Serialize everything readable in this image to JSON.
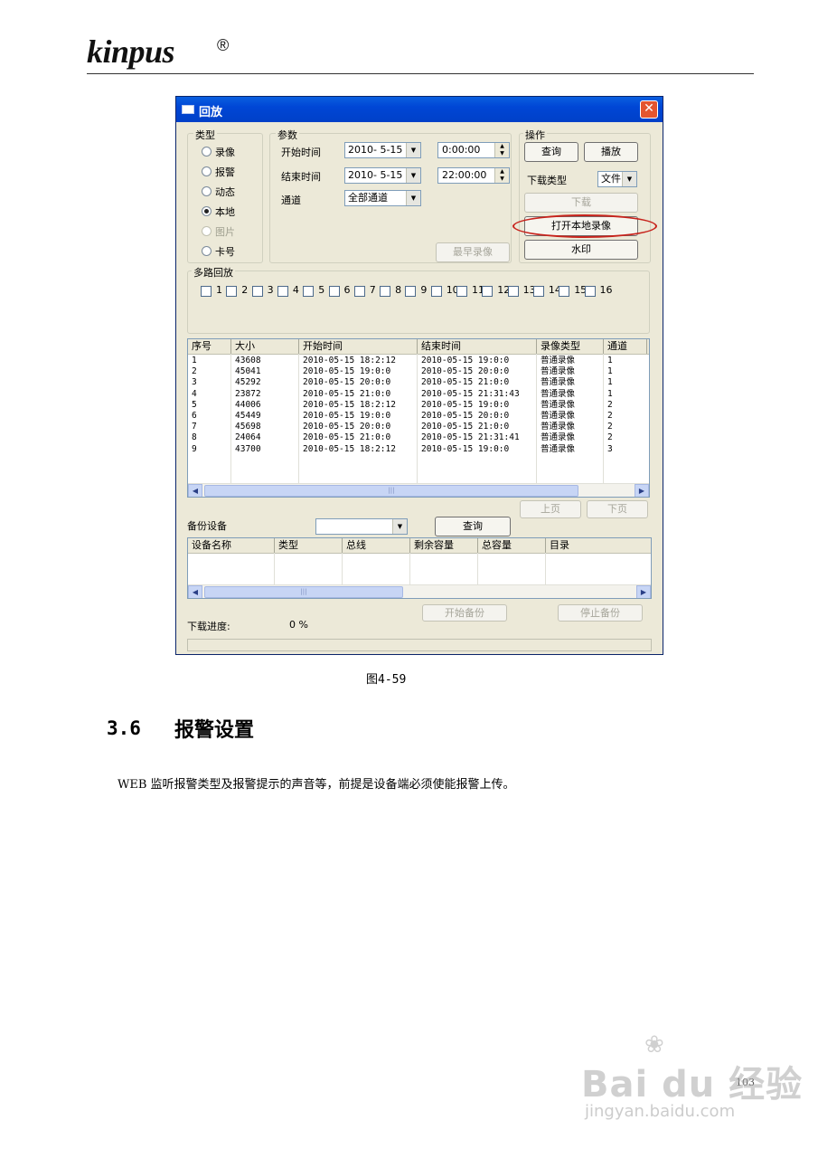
{
  "header": {
    "logo_text": "kinpus",
    "logo_mark": "®"
  },
  "dialog": {
    "title": "回放",
    "close_glyph": "✕",
    "type_group": {
      "legend": "类型",
      "options": [
        {
          "label": "录像",
          "checked": false,
          "enabled": true
        },
        {
          "label": "报警",
          "checked": false,
          "enabled": true
        },
        {
          "label": "动态",
          "checked": false,
          "enabled": true
        },
        {
          "label": "本地",
          "checked": true,
          "enabled": true
        },
        {
          "label": "图片",
          "checked": false,
          "enabled": false
        },
        {
          "label": "卡号",
          "checked": false,
          "enabled": true
        }
      ]
    },
    "params_group": {
      "legend": "参数",
      "start_label": "开始时间",
      "start_date": "2010- 5-15",
      "start_time": "0:00:00",
      "end_label": "结束时间",
      "end_date": "2010- 5-15",
      "end_time": "22:00:00",
      "channel_label": "通道",
      "channel_value": "全部通道",
      "earliest_button": "最早录像"
    },
    "ops_group": {
      "legend": "操作",
      "query_button": "查询",
      "play_button": "播放",
      "download_type_label": "下载类型",
      "download_type_value": "文件",
      "download_button": "下载",
      "open_local_button": "打开本地录像",
      "watermark_button": "水印",
      "highlight_color": "#c7231c"
    },
    "multi_group": {
      "legend": "多路回放",
      "channels": [
        "1",
        "2",
        "3",
        "4",
        "5",
        "6",
        "7",
        "8",
        "9",
        "10",
        "11",
        "12",
        "13",
        "14",
        "15",
        "16"
      ]
    },
    "records_table": {
      "columns": [
        "序号",
        "大小",
        "开始时间",
        "结束时间",
        "录像类型",
        "通道"
      ],
      "rows": [
        [
          "1",
          "43608",
          "2010-05-15 18:2:12",
          "2010-05-15 19:0:0",
          "普通录像",
          "1"
        ],
        [
          "2",
          "45041",
          "2010-05-15 19:0:0",
          "2010-05-15 20:0:0",
          "普通录像",
          "1"
        ],
        [
          "3",
          "45292",
          "2010-05-15 20:0:0",
          "2010-05-15 21:0:0",
          "普通录像",
          "1"
        ],
        [
          "4",
          "23872",
          "2010-05-15 21:0:0",
          "2010-05-15 21:31:43",
          "普通录像",
          "1"
        ],
        [
          "5",
          "44006",
          "2010-05-15 18:2:12",
          "2010-05-15 19:0:0",
          "普通录像",
          "2"
        ],
        [
          "6",
          "45449",
          "2010-05-15 19:0:0",
          "2010-05-15 20:0:0",
          "普通录像",
          "2"
        ],
        [
          "7",
          "45698",
          "2010-05-15 20:0:0",
          "2010-05-15 21:0:0",
          "普通录像",
          "2"
        ],
        [
          "8",
          "24064",
          "2010-05-15 21:0:0",
          "2010-05-15 21:31:41",
          "普通录像",
          "2"
        ],
        [
          "9",
          "43700",
          "2010-05-15 18:2:12",
          "2010-05-15 19:0:0",
          "普通录像",
          "3"
        ]
      ],
      "scroll_thumb_glyph": "|||"
    },
    "prev_page_button": "上页",
    "next_page_button": "下页",
    "backup": {
      "label": "备份设备",
      "device_value": "",
      "query_button": "查询",
      "columns": [
        "设备名称",
        "类型",
        "总线",
        "剩余容量",
        "总容量",
        "目录"
      ],
      "start_button": "开始备份",
      "stop_button": "停止备份"
    },
    "progress": {
      "label": "下载进度:",
      "value": "0 %"
    }
  },
  "caption": "图4-59",
  "section": {
    "number": "3.6",
    "title": "报警设置"
  },
  "body_text": "WEB 监听报警类型及报警提示的声音等，前提是设备端必须使能报警上传。",
  "page_number": "103",
  "watermark": {
    "logo": "Bai du 经验",
    "url": "jingyan.baidu.com"
  }
}
